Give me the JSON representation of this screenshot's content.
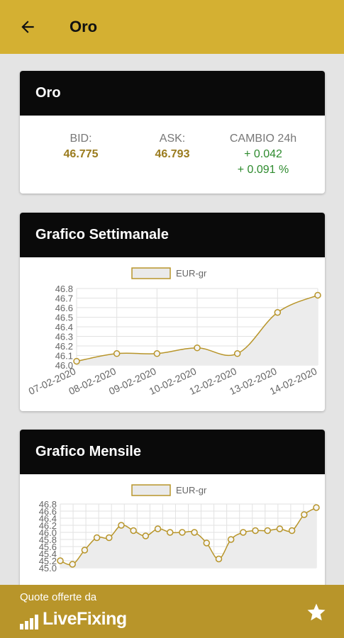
{
  "appbar": {
    "title": "Oro",
    "back_icon": "arrow-left-icon"
  },
  "quote_card": {
    "title": "Oro",
    "bid_label": "BID:",
    "bid_value": "46.775",
    "ask_label": "ASK:",
    "ask_value": "46.793",
    "change_label": "CAMBIO 24h",
    "change_abs": "+ 0.042",
    "change_pct": "+ 0.091 %"
  },
  "weekly_card": {
    "title": "Grafico Settimanale"
  },
  "monthly_card": {
    "title": "Grafico Mensile"
  },
  "footer": {
    "text": "Quote offerte da",
    "brand": "LiveFixing",
    "star_icon": "star-icon"
  },
  "colors": {
    "accent": "#d4b032",
    "footer": "#b8952a",
    "gold_text": "#9a7b1d",
    "up": "#2e8b2e"
  },
  "chart_data": [
    {
      "type": "line",
      "legend": "EUR-gr",
      "categories": [
        "07-02-2020",
        "08-02-2020",
        "09-02-2020",
        "10-02-2020",
        "12-02-2020",
        "13-02-2020",
        "14-02-2020"
      ],
      "series": [
        {
          "name": "EUR-gr",
          "values": [
            46.04,
            46.12,
            46.12,
            46.18,
            46.12,
            46.55,
            46.73
          ]
        }
      ],
      "yticks": [
        "46.8",
        "46.7",
        "46.6",
        "46.5",
        "46.4",
        "46.3",
        "46.2",
        "46.1",
        "46.0"
      ],
      "ylim": [
        46.0,
        46.8
      ],
      "grid": true
    },
    {
      "type": "line",
      "legend": "EUR-gr",
      "categories": [
        "",
        "",
        "",
        "",
        "",
        "",
        "",
        "",
        "",
        "",
        "",
        "",
        "",
        "",
        "",
        "",
        "",
        "",
        "",
        "",
        ""
      ],
      "series": [
        {
          "name": "EUR-gr",
          "values": [
            45.2,
            45.1,
            45.5,
            45.85,
            45.85,
            46.2,
            46.05,
            45.9,
            46.1,
            46.0,
            46.0,
            46.0,
            45.7,
            45.25,
            45.8,
            46.0,
            46.05,
            46.05,
            46.1,
            46.05,
            46.5,
            46.7
          ]
        }
      ],
      "yticks": [
        "46.8",
        "46.6",
        "46.4",
        "46.2",
        "46.0",
        "45.8",
        "45.6",
        "45.4",
        "45.2",
        "45.0"
      ],
      "ylim": [
        45.0,
        46.8
      ],
      "grid": true
    }
  ]
}
